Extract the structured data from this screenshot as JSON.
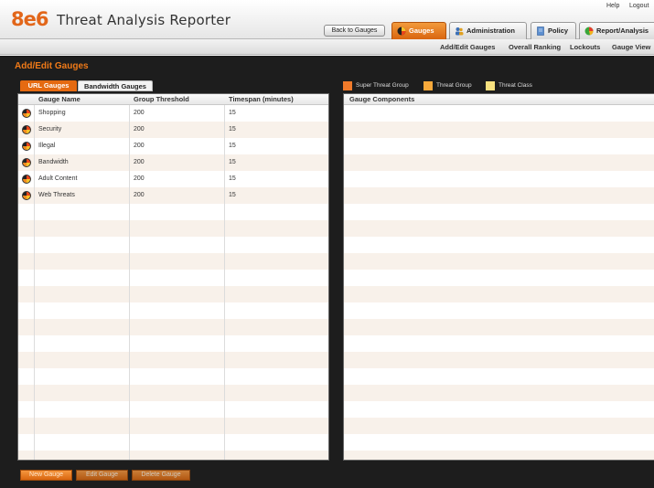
{
  "header": {
    "logo": "8e6",
    "app_title": "Threat Analysis Reporter",
    "help_label": "Help",
    "logout_label": "Logout",
    "back_button": "Back to Gauges",
    "tabs": [
      {
        "label": "Gauges",
        "icon": "gauge-icon",
        "active": true
      },
      {
        "label": "Administration",
        "icon": "users-icon",
        "active": false
      },
      {
        "label": "Policy",
        "icon": "policy-document-icon",
        "active": false
      },
      {
        "label": "Report/Analysis",
        "icon": "pie-chart-icon",
        "active": false
      }
    ]
  },
  "subnav": {
    "items": [
      "Add/Edit Gauges",
      "Overall Ranking",
      "Lockouts",
      "Gauge View"
    ]
  },
  "page": {
    "title": "Add/Edit Gauges",
    "subtabs": [
      {
        "label": "URL Gauges",
        "active": true
      },
      {
        "label": "Bandwidth Gauges",
        "active": false
      }
    ]
  },
  "legend": [
    {
      "label": "Super Threat Group",
      "color": "#f07a2a"
    },
    {
      "label": "Threat Group",
      "color": "#f7a93b"
    },
    {
      "label": "Threat Class",
      "color": "#f7e07e"
    }
  ],
  "gauges_table": {
    "columns": [
      "Gauge Name",
      "Group Threshold",
      "Timespan (minutes)"
    ],
    "rows": [
      {
        "name": "Shopping",
        "threshold": "200",
        "timespan": "15"
      },
      {
        "name": "Security",
        "threshold": "200",
        "timespan": "15"
      },
      {
        "name": "Illegal",
        "threshold": "200",
        "timespan": "15"
      },
      {
        "name": "Bandwidth",
        "threshold": "200",
        "timespan": "15"
      },
      {
        "name": "Adult Content",
        "threshold": "200",
        "timespan": "15"
      },
      {
        "name": "Web Threats",
        "threshold": "200",
        "timespan": "15"
      }
    ]
  },
  "components_panel": {
    "column": "Gauge Components"
  },
  "actions": {
    "new": "New Gauge",
    "edit": "Edit Gauge",
    "delete": "Delete Gauge"
  },
  "colors": {
    "accent": "#f07a18",
    "row_alt": "#f8f1ea",
    "background": "#1d1d1d"
  }
}
